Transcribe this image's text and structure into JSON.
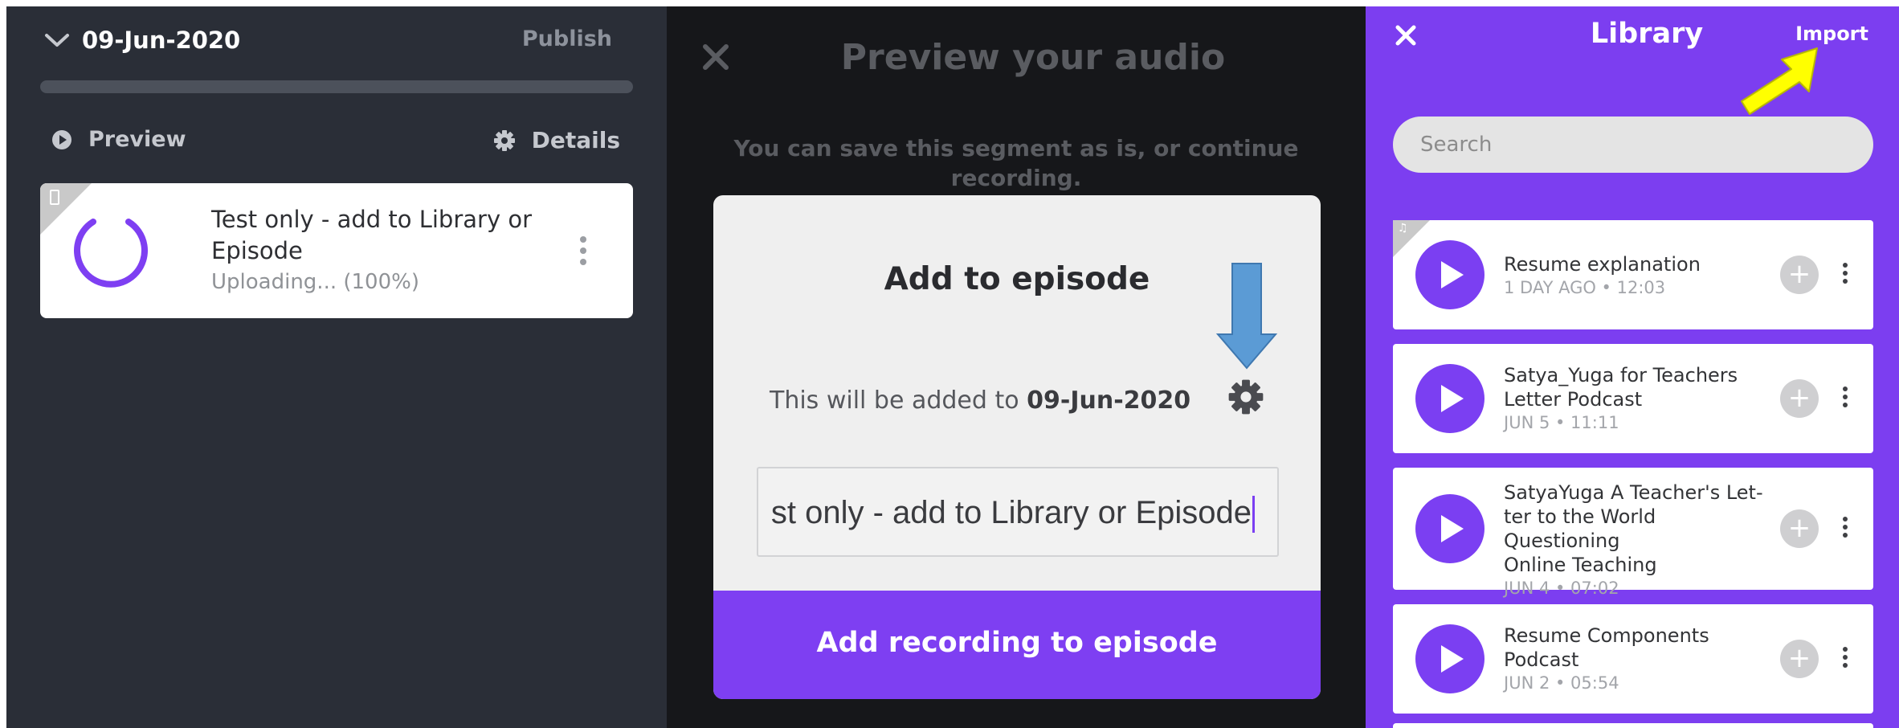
{
  "episode_panel": {
    "date": "09-Jun-2020",
    "publish_label": "Publish",
    "preview_label": "Preview",
    "details_label": "Details",
    "upload_card": {
      "title": "Test only - add to Library or Episode",
      "status": "Uploading... (100%)"
    }
  },
  "preview_panel": {
    "title": "Preview your audio",
    "description": "You can save this segment as is, or continue recording.",
    "dialog": {
      "title": "Add to episode",
      "added_to_prefix": "This will be added to ",
      "added_to_date": "09-Jun-2020",
      "name_value": "st only - add to Library or Episode",
      "cta_label": "Add recording to episode"
    },
    "annotation_arrow_color": "#5b9bd5"
  },
  "library_panel": {
    "title": "Library",
    "import_label": "Import",
    "search_placeholder": "Search",
    "annotation_arrow_color": "#ffff00",
    "items": [
      {
        "lines": [
          "Resume explanation"
        ],
        "meta": "1 DAY AGO • 12:03"
      },
      {
        "lines": [
          "Satya_Yuga for Teachers",
          "Letter Podcast"
        ],
        "meta": "JUN 5 • 11:11"
      },
      {
        "lines": [
          "SatyaYuga A Teacher's Let-",
          "ter to the World Questioning",
          "Online Teaching"
        ],
        "meta": "JUN 4 • 07:02"
      },
      {
        "lines": [
          "Resume Components",
          "Podcast"
        ],
        "meta": "JUN 2 • 05:54"
      }
    ]
  },
  "colors": {
    "accent": "#7e3ff2",
    "library_bg": "#7c3ef0",
    "dark_panel": "#2a2e37"
  }
}
